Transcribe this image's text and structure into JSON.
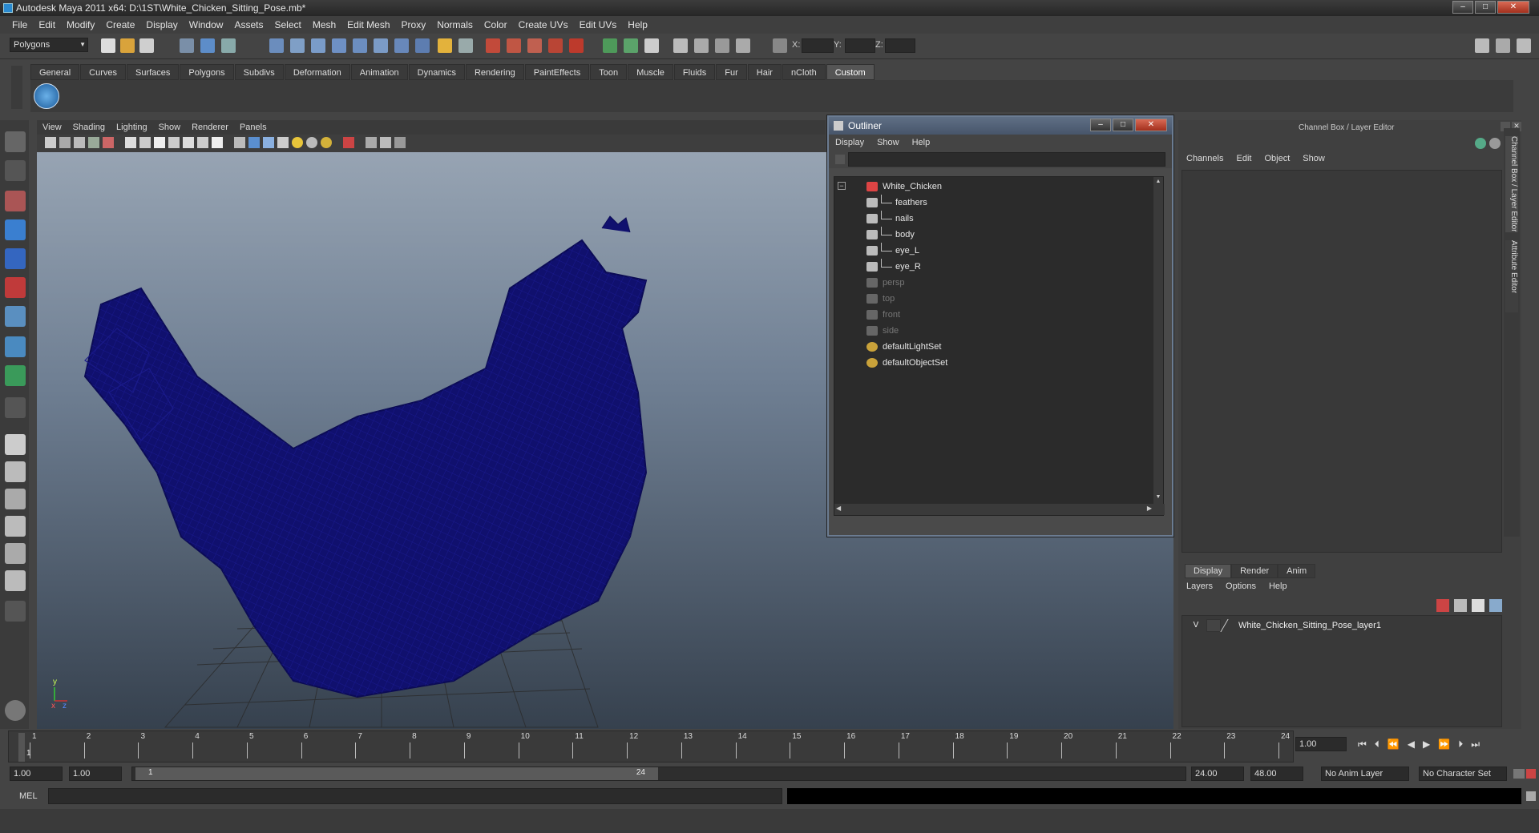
{
  "window": {
    "title": "Autodesk Maya 2011 x64: D:\\1ST\\White_Chicken_Sitting_Pose.mb*",
    "minimize": "–",
    "maximize": "□",
    "close": "✕"
  },
  "menubar": [
    "File",
    "Edit",
    "Modify",
    "Create",
    "Display",
    "Window",
    "Assets",
    "Select",
    "Mesh",
    "Edit Mesh",
    "Proxy",
    "Normals",
    "Color",
    "Create UVs",
    "Edit UVs",
    "Help"
  ],
  "status_line": {
    "mode": "Polygons",
    "x_label": "X:",
    "y_label": "Y:",
    "z_label": "Z:"
  },
  "shelf_tabs": [
    "General",
    "Curves",
    "Surfaces",
    "Polygons",
    "Subdivs",
    "Deformation",
    "Animation",
    "Dynamics",
    "Rendering",
    "PaintEffects",
    "Toon",
    "Muscle",
    "Fluids",
    "Fur",
    "Hair",
    "nCloth",
    "Custom"
  ],
  "active_shelf_tab": "Custom",
  "viewport": {
    "menu": [
      "View",
      "Shading",
      "Lighting",
      "Show",
      "Renderer",
      "Panels"
    ],
    "axis_y": "y",
    "axis_x": "x",
    "axis_z": "z",
    "wire_color": "#10106e"
  },
  "outliner": {
    "title": "Outliner",
    "menu": [
      "Display",
      "Show",
      "Help"
    ],
    "expander": "−",
    "items": [
      {
        "label": "White_Chicken",
        "level": 0,
        "dim": false
      },
      {
        "label": "feathers",
        "level": 1,
        "dim": false
      },
      {
        "label": "nails",
        "level": 1,
        "dim": false
      },
      {
        "label": "body",
        "level": 1,
        "dim": false
      },
      {
        "label": "eye_L",
        "level": 1,
        "dim": false
      },
      {
        "label": "eye_R",
        "level": 1,
        "dim": false
      },
      {
        "label": "persp",
        "level": 0,
        "dim": true
      },
      {
        "label": "top",
        "level": 0,
        "dim": true
      },
      {
        "label": "front",
        "level": 0,
        "dim": true
      },
      {
        "label": "side",
        "level": 0,
        "dim": true
      },
      {
        "label": "defaultLightSet",
        "level": 0,
        "dim": false
      },
      {
        "label": "defaultObjectSet",
        "level": 0,
        "dim": false
      }
    ]
  },
  "channel_box": {
    "title": "Channel Box / Layer Editor",
    "menu": [
      "Channels",
      "Edit",
      "Object",
      "Show"
    ],
    "side_tab_1": "Channel Box / Layer Editor",
    "side_tab_2": "Attribute Editor",
    "layer_tabs": [
      "Display",
      "Render",
      "Anim"
    ],
    "layer_menu": [
      "Layers",
      "Options",
      "Help"
    ],
    "layer": {
      "visible": "V",
      "name": "White_Chicken_Sitting_Pose_layer1"
    }
  },
  "timeline": {
    "ticks": [
      "1",
      "2",
      "3",
      "4",
      "5",
      "6",
      "7",
      "8",
      "9",
      "10",
      "11",
      "12",
      "13",
      "14",
      "15",
      "16",
      "17",
      "18",
      "19",
      "20",
      "21",
      "22",
      "23",
      "24"
    ],
    "current_frame": "1",
    "current_time": "1.00"
  },
  "range": {
    "start": "1.00",
    "anim_start": "1.00",
    "range_start": "1",
    "range_end": "24",
    "end": "24.00",
    "anim_end": "48.00",
    "anim_layer": "No Anim Layer",
    "character_set": "No Character Set"
  },
  "command_line": {
    "label": "MEL"
  }
}
